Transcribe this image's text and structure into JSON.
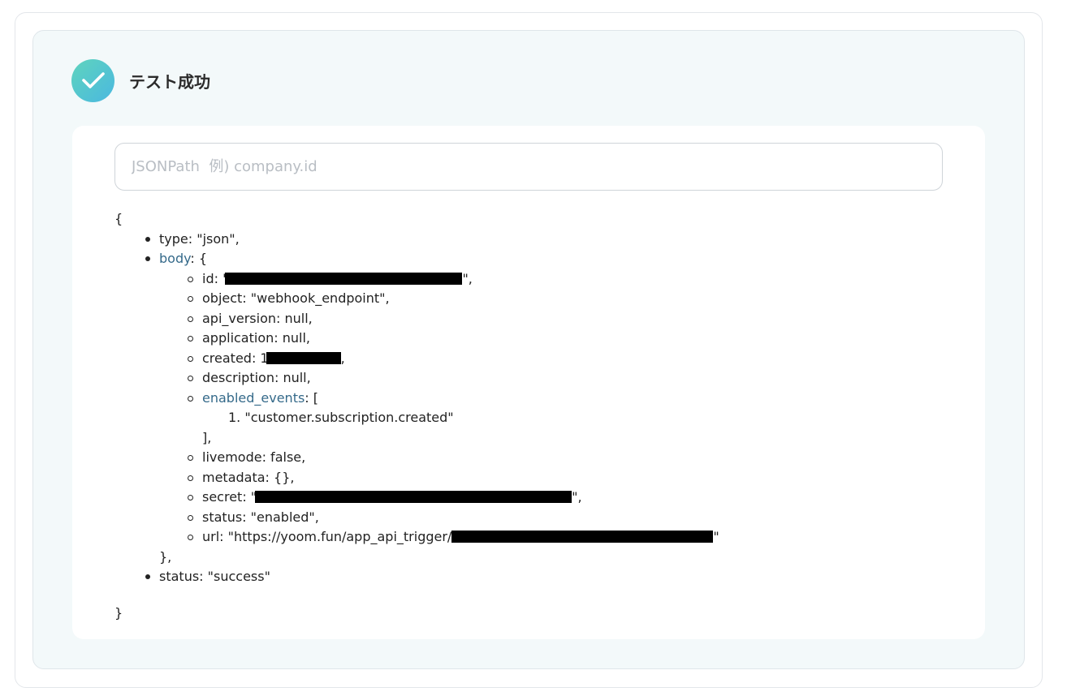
{
  "header": {
    "title": "テスト成功",
    "icon": "check-icon"
  },
  "search": {
    "placeholder": "JSONPath  例) company.id",
    "value": ""
  },
  "json": {
    "open_brace": "{",
    "close_brace": "}",
    "type_line": "type: \"json\",",
    "body_key": "body",
    "body_open": ": {",
    "id_prefix": "id: \"",
    "id_suffix": "\",",
    "object_line": "object: \"webhook_endpoint\",",
    "api_version_line": "api_version: null,",
    "application_line": "application: null,",
    "created_prefix": "created: 1",
    "created_suffix": ",",
    "description_line": "description: null,",
    "enabled_events_key": "enabled_events",
    "enabled_events_open": ": [",
    "event_1": "1. \"customer.subscription.created\"",
    "enabled_events_close": "],",
    "livemode_line": "livemode: false,",
    "metadata_line": "metadata: {},",
    "secret_prefix": "secret: \"",
    "secret_suffix": "\",",
    "status_inner_line": "status: \"enabled\",",
    "url_prefix": "url: \"https://yoom.fun/app_api_trigger/",
    "url_suffix": "\"",
    "body_close": "},",
    "status_line": "status: \"success\""
  }
}
